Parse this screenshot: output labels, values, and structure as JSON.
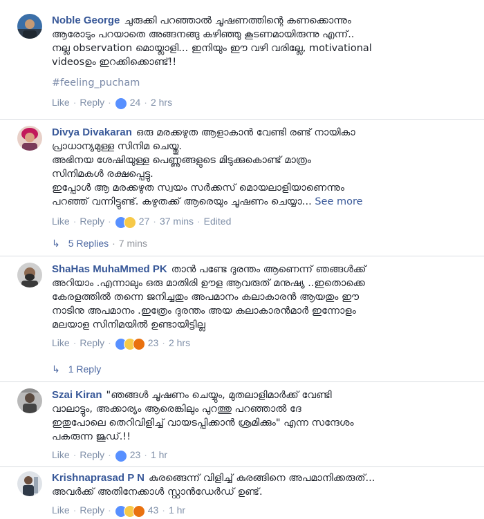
{
  "action_labels": {
    "like": "Like",
    "reply": "Reply"
  },
  "comments": [
    {
      "author": "Noble George",
      "lines": [
        "ചുരുക്കി പറഞ്ഞാൽ ചൂഷണത്തിന്റെ കണക്കൊന്നും",
        "ആരോടും പറയാതെ അങ്ങനങ്ങു കഴിഞ്ഞു കൂടണമായിരുന്നു എന്ന്..",
        "നല്ല observation മൊയ്ലാളി... ഇനിയും ഈ വഴി വരില്ലേ, motivational",
        "videosഉം ഇറക്കിക്കൊണ്ട്!!"
      ],
      "hashtag": "#feeling_pucham",
      "reaction_count": "24",
      "time": "2 hrs"
    },
    {
      "author": "Divya Divakaran",
      "lines": [
        "ഒരു മരക്കഴുത ആളാകാൻ വേണ്ടി രണ്ട് നായികാ",
        "പ്രാധാന്യമുള്ള സിനിമ ചെയ്തു.",
        "അഭിനയ ശേഷിയുള്ള പെണ്ണുങ്ങളുടെ മിടുക്കുകൊണ്ട് മാത്രം",
        "സിനിമകൾ രക്ഷപ്പെട്ടു.",
        "ഇപ്പോൾ ആ മരക്കഴുത സ്വയം സർക്കസ് മൊയലാളിയാണെന്നും",
        "പറഞ്ഞ് വന്നിട്ടുണ്ട്. കഴുതക്ക് ആരെയും ചൂഷണം ചെയ്യാ..."
      ],
      "see_more": "See more",
      "reaction_count": "27",
      "time": "37 mins",
      "edited": "Edited",
      "replies_label": "5 Replies",
      "replies_time": "7 mins"
    },
    {
      "author": "ShaHas MuhaMmed PK",
      "lines": [
        "താൻ പണ്ടേ ദുരന്തം ആണെന്ന് ഞങ്ങൾക്ക്",
        "അറിയാം .എന്നാലും ഒരു മാതിരി ഊള ആവരുത് മനുഷ്യ ..ഇതൊക്കെ",
        "കേരളത്തിൽ തന്നെ ജനിച്ചതും അപമാനം കലാകാരൻ ആയതും ഈ",
        "നാടിനു അപമാനം .ഇത്രേം ദുരന്തം അയ കലാകാരൻമാർ ഇന്നോളം",
        "മലയാള സിനിമയിൽ ഉണ്ടായിട്ടില്ല"
      ],
      "reaction_count": "23",
      "time": "2 hrs",
      "replies_label": "1 Reply"
    },
    {
      "author": "Szai Kiran",
      "lines": [
        "\"ഞങ്ങൾ ചൂഷണം ചെയ്യും, മുതലാളിമാർക്ക് വേണ്ടി",
        "വാലാട്ടും, അക്കാര്യം ആരെങ്കിലും പുറത്തു പറഞ്ഞാൽ ദേ",
        "ഇതുപോലെ തെറിവിളിച്ച് വായടപ്പിക്കാൻ ശ്രമിക്കും\" എന്ന സന്ദേശം",
        "പകരുന്ന ജൂഡ്.!!"
      ],
      "reaction_count": "23",
      "time": "1 hr"
    },
    {
      "author": "Krishnaprasad P N",
      "lines": [
        "കുരങ്ങെന്ന് വിളിച്ച് കുരങ്ങിനെ അപമാനിക്കരുത്...",
        "അവർക്ക് അതിനേക്കാൾ സ്റ്റാൻഡേർഡ് ഉണ്ട്."
      ],
      "reaction_count": "43",
      "time": "1 hr"
    }
  ]
}
